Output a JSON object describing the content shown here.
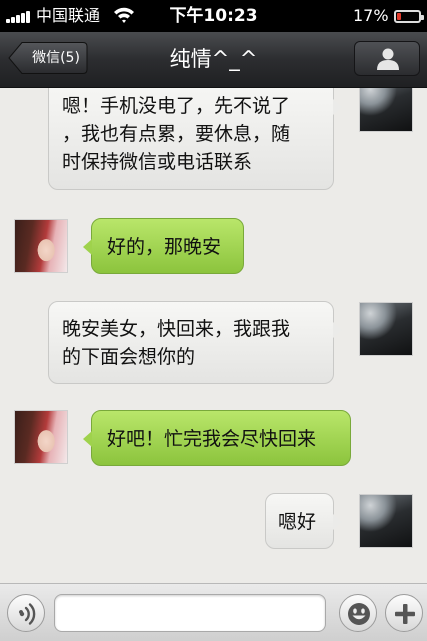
{
  "status_bar": {
    "carrier": "中国联通",
    "time": "下午10:23",
    "battery_percent": "17%",
    "battery_level": 0.17,
    "battery_color": "#e23a2b"
  },
  "nav": {
    "back_label": "微信(5)",
    "title": "纯情^_^",
    "profile_icon": "person-icon"
  },
  "messages": [
    {
      "side": "right",
      "text_lines": [
        "嗯！手机没电了，先不说了",
        "，我也有点累，要休息，随",
        "时保持微信或电话联系"
      ],
      "avatar": "car-photo"
    },
    {
      "side": "left",
      "text_lines": [
        "好的，那晚安"
      ],
      "avatar": "girl-photo"
    },
    {
      "side": "right",
      "text_lines": [
        "晚安美女，快回来，我跟我",
        "的下面会想你的"
      ],
      "avatar": "car-photo"
    },
    {
      "side": "left",
      "text_lines": [
        "好吧！忙完我会尽快回来"
      ],
      "avatar": "girl-photo"
    },
    {
      "side": "right",
      "text_lines": [
        "嗯好"
      ],
      "avatar": "car-photo"
    }
  ],
  "input_bar": {
    "voice_icon": "voice-icon",
    "emoji_icon": "smiley-icon",
    "add_icon": "plus-icon",
    "placeholder": ""
  },
  "colors": {
    "outgoing_bubble": "#e9e9e7",
    "incoming_bubble": "#9fd24c",
    "nav_bar": "#2c2d30"
  }
}
